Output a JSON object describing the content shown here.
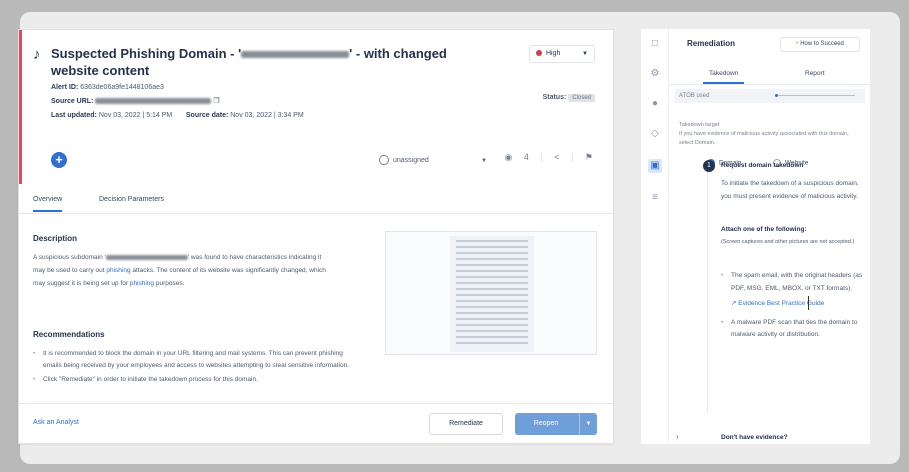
{
  "alert": {
    "title_prefix": "Suspected Phishing Domain - '",
    "title_suffix": "' - with changed website content",
    "severity": "High",
    "alert_id_label": "Alert ID:",
    "alert_id": "6363de06a9fe1448106ae3",
    "source_url_label": "Source URL:",
    "status_label": "Status:",
    "status": "Closed",
    "last_updated_label": "Last updated:",
    "last_updated": "Nov 03, 2022 | 5:14 PM",
    "source_date_label": "Source date:",
    "source_date": "Nov 03, 2022 | 3:34 PM",
    "assignee": "unassigned",
    "watchers": "4"
  },
  "tabs": [
    "Overview",
    "Decision Parameters"
  ],
  "overview": {
    "description_heading": "Description",
    "description_pre": "A suspicious subdomain '",
    "description_mid": "' was found to have characteristics indicating it may be used to carry out ",
    "description_link1": "phishing",
    "description_post": " attacks. The content of its website was significantly changed, which may suggest it is being set up for ",
    "description_link2": "phishing",
    "description_end": " purposes.",
    "recommendations_heading": "Recommendations",
    "recommendations": [
      "It is recommended to block the domain in your URL filtering and mail systems. This can prevent phishing emails being received by your employees and access to websites attempting to steal sensitive information.",
      "Click \"Remediate\" in order to initiate the takedown process for this domain."
    ]
  },
  "footer": {
    "ask_analyst": "Ask an Analyst",
    "remediate": "Remediate",
    "reopen": "Reopen"
  },
  "remediation": {
    "title": "Remediation",
    "how_to": "How to Succeed",
    "tabs": [
      "Takedown",
      "Report"
    ],
    "progress_label": "ATOB used",
    "takedown_target_label": "Takedown target",
    "takedown_target_hint": "If you have evidence of malicious activity associated with this domain, select Domain.",
    "radio_domain": "Domain",
    "radio_website": "Website",
    "step_number": "1",
    "step_title": "Request domain takedown",
    "step_text": "To initiate the takedown of a suspicious domain, you must present evidence of malicious activity.",
    "attach_heading": "Attach one of the following:",
    "attach_note": "(Screen captures and other pictures are not accepted.)",
    "attach_items": [
      "The spam email, with the original headers (as PDF, MSG, EML, MBOX, or TXT formats).",
      "A malware PDF scan that ties the domain to malware activity or distribution."
    ],
    "evidence_link": "Evidence Best Practice Guide",
    "no_evidence": "Don't have evidence?"
  }
}
